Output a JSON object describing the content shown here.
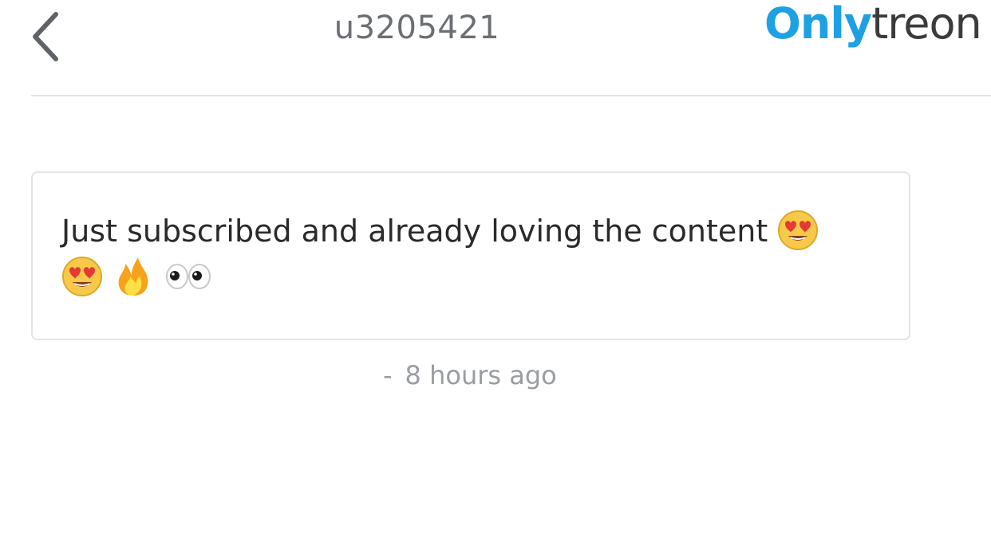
{
  "header": {
    "title": "u3205421",
    "back_icon": "chevron-left-icon",
    "logo": {
      "part1": "Only",
      "part2": "treon",
      "part1_color": "#1da1e2",
      "part2_color": "#3b3b3b"
    }
  },
  "message": {
    "text": "Just subscribed and already loving the content",
    "emojis": [
      "heart-eyes-emoji",
      "heart-eyes-emoji",
      "fire-emoji",
      "eyes-emoji"
    ]
  },
  "meta": {
    "separator": "-",
    "time_ago": "8 hours ago"
  }
}
